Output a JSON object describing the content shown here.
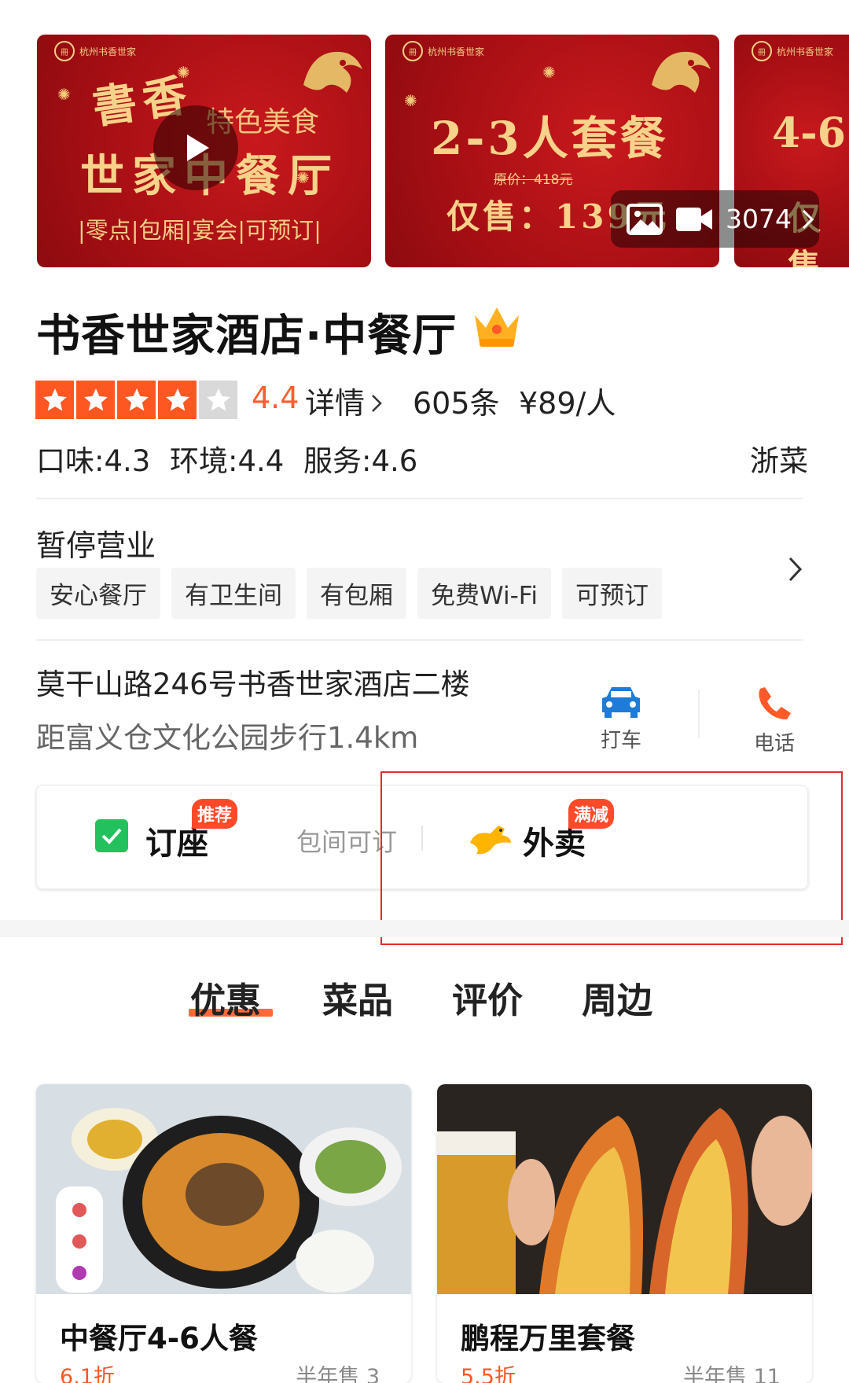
{
  "banner": {
    "logo_text": "杭州书香世家",
    "slide1": {
      "title_top": "書香",
      "title_bottom": "世家中餐厅",
      "subtitle": "特色美食",
      "features": "|零点|包厢|宴会|可预订|"
    },
    "slide2": {
      "title": "2-3人套餐",
      "original_price": "原价：418元",
      "price": "仅售：139元"
    },
    "slide3": {
      "title": "4-6",
      "price": "仅售"
    },
    "media_count": "3074",
    "media_icons": [
      "image-icon",
      "video-icon"
    ]
  },
  "shop": {
    "name": "书香世家酒店·中餐厅",
    "badge_icon": "crown-icon",
    "rating": "4.4",
    "rating_stars": 4,
    "detail_label": "详情",
    "review_count": "605条",
    "avg_price": "¥89/人",
    "scores": {
      "taste": "口味:4.3",
      "environment": "环境:4.4",
      "service": "服务:4.6"
    },
    "cuisine": "浙菜",
    "status": "暂停营业",
    "tags": [
      "安心餐厅",
      "有卫生间",
      "有包厢",
      "免费Wi-Fi",
      "可预订"
    ],
    "address": "莫干山路246号书香世家酒店二楼",
    "distance": "距富义仓文化公园步行1.4km",
    "actions": {
      "taxi": "打车",
      "call": "电话"
    }
  },
  "services": {
    "booking_label": "订座",
    "booking_badge": "推荐",
    "booking_note": "包间可订",
    "takeout_label": "外卖",
    "takeout_badge": "满减"
  },
  "tabs": [
    "优惠",
    "菜品",
    "评价",
    "周边"
  ],
  "active_tab": "优惠",
  "deals": [
    {
      "name": "中餐厅4-6人餐",
      "discount": "6.1折",
      "sold": "半年售 3"
    },
    {
      "name": "鹏程万里套餐",
      "discount": "5.5折",
      "sold": "半年售 11"
    }
  ],
  "colors": {
    "accent": "#ff5722",
    "banner_red": "#a70f14",
    "gold": "#f6d28a",
    "highlight_box": "#e02c2c"
  }
}
